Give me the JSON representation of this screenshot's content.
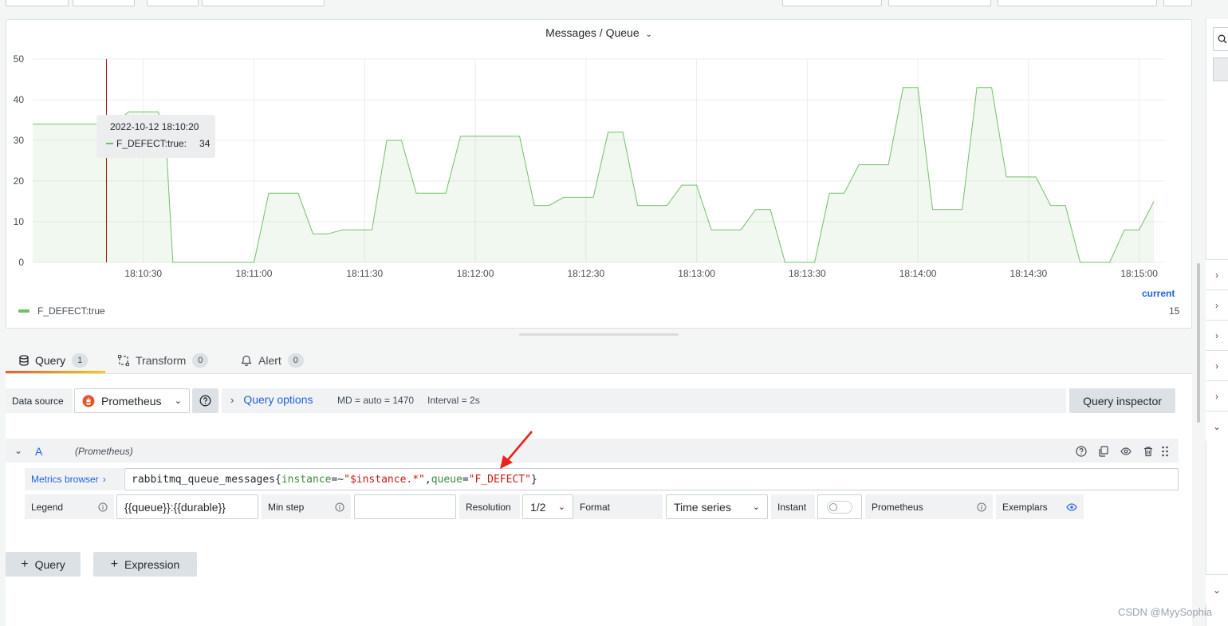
{
  "panel": {
    "title": "Messages / Queue",
    "legend_header": "current",
    "legend_series": "F_DEFECT:true",
    "legend_value": "15"
  },
  "tooltip": {
    "time": "2022-10-12 18:10:20",
    "series": "F_DEFECT:true:",
    "value": "34"
  },
  "chart_data": {
    "type": "area",
    "series": [
      {
        "name": "F_DEFECT:true",
        "color": "#73bf69",
        "points": [
          [
            "18:10:00",
            34
          ],
          [
            "18:10:22",
            34
          ],
          [
            "18:10:26",
            37
          ],
          [
            "18:10:34",
            37
          ],
          [
            "18:10:36",
            32
          ],
          [
            "18:10:38",
            0
          ],
          [
            "18:11:00",
            0
          ],
          [
            "18:11:04",
            17
          ],
          [
            "18:11:12",
            17
          ],
          [
            "18:11:16",
            7
          ],
          [
            "18:11:20",
            7
          ],
          [
            "18:11:24",
            8
          ],
          [
            "18:11:32",
            8
          ],
          [
            "18:11:36",
            30
          ],
          [
            "18:11:40",
            30
          ],
          [
            "18:11:44",
            17
          ],
          [
            "18:11:52",
            17
          ],
          [
            "18:11:56",
            31
          ],
          [
            "18:12:12",
            31
          ],
          [
            "18:12:16",
            14
          ],
          [
            "18:12:20",
            14
          ],
          [
            "18:12:24",
            16
          ],
          [
            "18:12:32",
            16
          ],
          [
            "18:12:36",
            32
          ],
          [
            "18:12:40",
            32
          ],
          [
            "18:12:44",
            14
          ],
          [
            "18:12:52",
            14
          ],
          [
            "18:12:56",
            19
          ],
          [
            "18:13:00",
            19
          ],
          [
            "18:13:04",
            8
          ],
          [
            "18:13:12",
            8
          ],
          [
            "18:13:16",
            13
          ],
          [
            "18:13:20",
            13
          ],
          [
            "18:13:24",
            0
          ],
          [
            "18:13:32",
            0
          ],
          [
            "18:13:36",
            17
          ],
          [
            "18:13:40",
            17
          ],
          [
            "18:13:44",
            24
          ],
          [
            "18:13:52",
            24
          ],
          [
            "18:13:56",
            43
          ],
          [
            "18:14:00",
            43
          ],
          [
            "18:14:04",
            13
          ],
          [
            "18:14:12",
            13
          ],
          [
            "18:14:16",
            43
          ],
          [
            "18:14:20",
            43
          ],
          [
            "18:14:24",
            21
          ],
          [
            "18:14:32",
            21
          ],
          [
            "18:14:36",
            14
          ],
          [
            "18:14:40",
            14
          ],
          [
            "18:14:44",
            0
          ],
          [
            "18:14:52",
            0
          ],
          [
            "18:14:56",
            8
          ],
          [
            "18:15:00",
            8
          ],
          [
            "18:15:04",
            15
          ]
        ]
      }
    ],
    "x_ticks": [
      "18:10:30",
      "18:11:00",
      "18:11:30",
      "18:12:00",
      "18:12:30",
      "18:13:00",
      "18:13:30",
      "18:14:00",
      "18:14:30",
      "18:15:00"
    ],
    "y_ticks": [
      "50",
      "40",
      "30",
      "20",
      "10",
      "0"
    ],
    "ylim": [
      0,
      50
    ],
    "grid": true,
    "cursor_time": "18:10:20"
  },
  "tabs": [
    {
      "label": "Query",
      "count": "1"
    },
    {
      "label": "Transform",
      "count": "0"
    },
    {
      "label": "Alert",
      "count": "0"
    }
  ],
  "datasource": {
    "label": "Data source",
    "value": "Prometheus",
    "query_options": "Query options",
    "md": "MD = auto = 1470",
    "interval": "Interval = 2s",
    "inspector": "Query inspector"
  },
  "query_row": {
    "ref": "A",
    "source": "(Prometheus)",
    "metrics_browser": "Metrics browser",
    "expr": {
      "metric": "rabbitmq_queue_messages",
      "open": "{",
      "k1": "instance",
      "op1": "=~",
      "v1": "\"$instance.*\"",
      "comma": ",",
      "k2": "queue",
      "op2": "=",
      "v2": "\"F_DEFECT\"",
      "close": "}"
    }
  },
  "options": {
    "legend_label": "Legend",
    "legend_value": "{{queue}}:{{durable}}",
    "minstep_label": "Min step",
    "minstep_value": "",
    "resolution_label": "Resolution",
    "resolution_value": "1/2",
    "format_label": "Format",
    "format_value": "Time series",
    "instant_label": "Instant",
    "prometheus_label": "Prometheus",
    "exemplars_label": "Exemplars"
  },
  "buttons": {
    "add_query": "Query",
    "add_expression": "Expression"
  },
  "watermark": "CSDN @MyySophia"
}
